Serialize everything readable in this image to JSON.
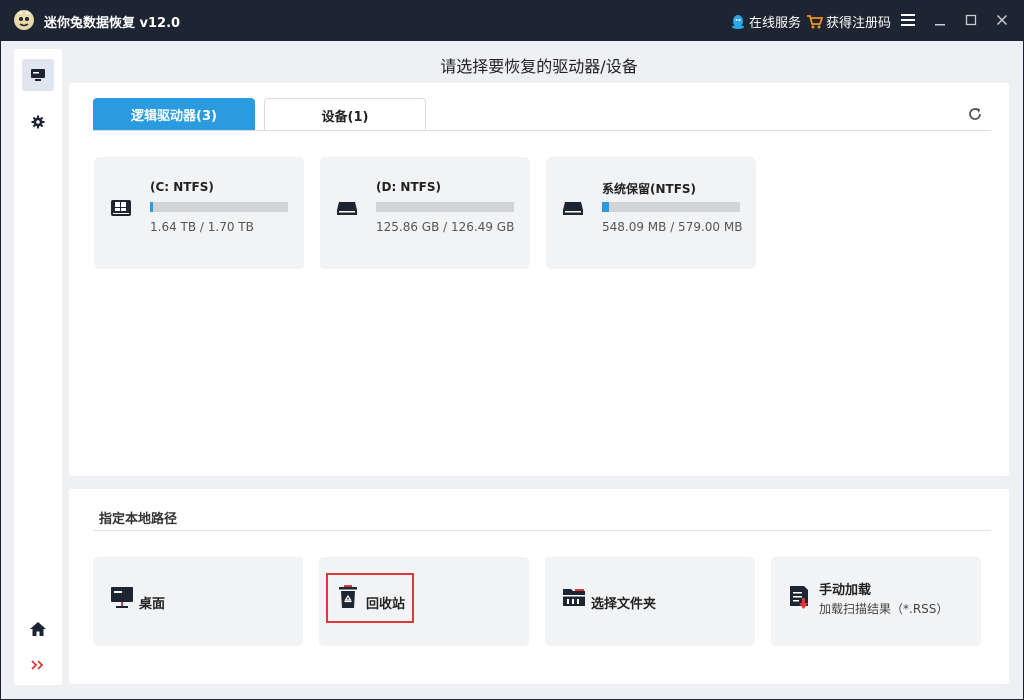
{
  "titlebar": {
    "title": "迷你兔数据恢复 v12.0",
    "online_service": "在线服务",
    "get_code": "获得注册码"
  },
  "page": {
    "title": "请选择要恢复的驱动器/设备"
  },
  "tabs": [
    {
      "label": "逻辑驱动器(3)",
      "active": true
    },
    {
      "label": "设备(1)",
      "active": false
    }
  ],
  "drives": [
    {
      "name": "(C: NTFS)",
      "size": "1.64 TB / 1.70 TB",
      "used_fraction": 0.025,
      "icon": "windows-drive-icon"
    },
    {
      "name": "(D: NTFS)",
      "size": "125.86 GB / 126.49 GB",
      "used_fraction": 0.0,
      "icon": "hard-drive-icon"
    },
    {
      "name": "系统保留(NTFS)",
      "size": "548.09 MB / 579.00 MB",
      "used_fraction": 0.05,
      "icon": "hard-drive-icon"
    }
  ],
  "local_path": {
    "title": "指定本地路径",
    "items": [
      {
        "label": "桌面",
        "icon": "desktop-icon"
      },
      {
        "label": "回收站",
        "icon": "recycle-bin-icon"
      },
      {
        "label": "选择文件夹",
        "icon": "folder-icon"
      },
      {
        "label": "手动加载",
        "sub": "加载扫描结果（*.RSS）",
        "icon": "manual-load-icon"
      }
    ]
  },
  "colors": {
    "accent": "#2b9be0",
    "titlebar": "#1d2533",
    "highlight": "#d9393b"
  }
}
